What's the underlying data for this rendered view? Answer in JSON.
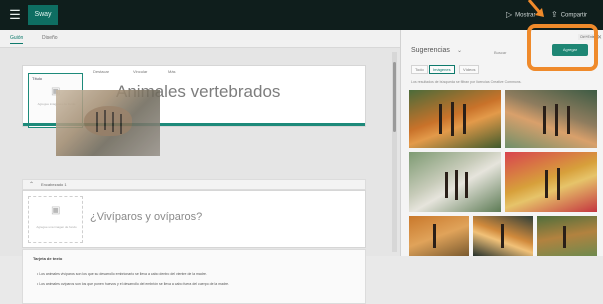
{
  "topbar": {
    "app_name": "Sway",
    "menu_icon": "waffle-icon",
    "actions": [
      {
        "icon": "play-icon",
        "label": "Mostrar"
      },
      {
        "icon": "share-icon",
        "label": "Compartir"
      }
    ]
  },
  "subbar": {
    "tabs": [
      {
        "label": "Guión",
        "active": true
      },
      {
        "label": "Diseño",
        "active": false
      }
    ]
  },
  "storyline": {
    "card1": {
      "tag": "Título",
      "placeholder": "Agregue imágenes de fondo",
      "tools": [
        "Destacar",
        "Vincular",
        "Más"
      ],
      "title": "Animales vertebrados"
    },
    "section": {
      "label": "Encabezado 1"
    },
    "card2": {
      "placeholder": "Agregue una imagen de fondo",
      "title": "¿Vivíparos y ovíparos?"
    },
    "notes": {
      "title": "Tarjeta de texto",
      "bullets": [
        "Los animales vivíparos son los que su desarrollo embrionario se lleva a cabo dentro del vientre de la madre.",
        "Los animales ovíparos son los que ponen huevos y el desarrollo del embrión se lleva a cabo fuera del cuerpo de la madre."
      ]
    }
  },
  "panel": {
    "title": "Sugerencias",
    "subtitle": "Buscar",
    "chips": [
      {
        "label": "Todo",
        "selected": false
      },
      {
        "label": "Imágenes",
        "selected": true
      },
      {
        "label": "Vídeos",
        "selected": false
      }
    ],
    "caption": "Los resultados de búsqueda se filtran por licencias Creative Commons.",
    "insert_label": "Agregar",
    "close_icon": "close-icon",
    "command_label": "Ctrl+Enter"
  },
  "colors": {
    "accent": "#1d8a7a",
    "topbar": "#0f1e1c",
    "highlight": "#ef8a2b"
  }
}
